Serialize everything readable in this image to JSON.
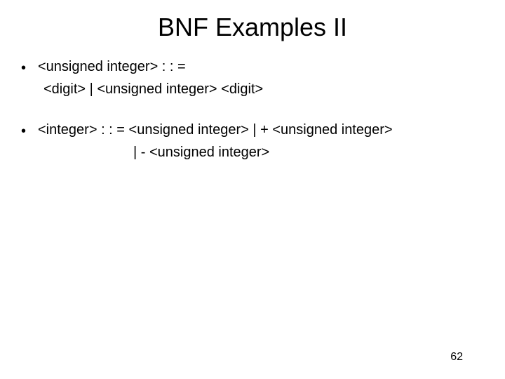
{
  "title": "BNF Examples II",
  "bullets": [
    {
      "line1": "<unsigned integer> : : =",
      "line2": "<digit> | <unsigned integer> <digit>"
    },
    {
      "line1": "<integer> : : = <unsigned integer> |  + <unsigned integer>",
      "line2": "|  - <unsigned integer>"
    }
  ],
  "pageNumber": "62"
}
